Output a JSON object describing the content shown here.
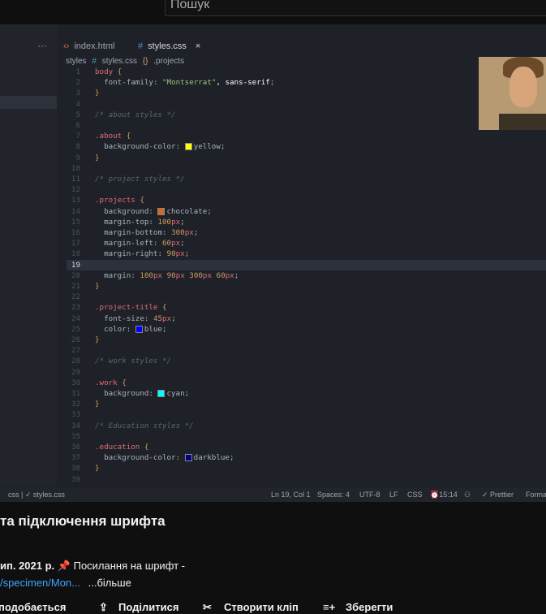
{
  "search": {
    "placeholder": "Пошук"
  },
  "editor": {
    "more_tabs": "···",
    "tabs": [
      {
        "icon": "‹›",
        "label": "index.html"
      },
      {
        "icon": "#",
        "label": "styles.css",
        "close": "×"
      }
    ],
    "breadcrumb": [
      "styles",
      "#",
      "styles.css",
      "{}",
      ".projects"
    ],
    "current_line": 19,
    "lines": [
      {
        "n": 1,
        "text": "body {"
      },
      {
        "n": 2,
        "text": "  font-family: \"Montserrat\", sans-serif;"
      },
      {
        "n": 3,
        "text": "}"
      },
      {
        "n": 4,
        "text": ""
      },
      {
        "n": 5,
        "text": "/* about styles */"
      },
      {
        "n": 6,
        "text": ""
      },
      {
        "n": 7,
        "text": ".about {"
      },
      {
        "n": 8,
        "text": "  background-color: yellow;"
      },
      {
        "n": 9,
        "text": "}"
      },
      {
        "n": 10,
        "text": ""
      },
      {
        "n": 11,
        "text": "/* project styles */"
      },
      {
        "n": 12,
        "text": ""
      },
      {
        "n": 13,
        "text": ".projects {"
      },
      {
        "n": 14,
        "text": "  background: chocolate;"
      },
      {
        "n": 15,
        "text": "  margin-top: 100px;"
      },
      {
        "n": 16,
        "text": "  margin-bottom: 300px;"
      },
      {
        "n": 17,
        "text": "  margin-left: 60px;"
      },
      {
        "n": 18,
        "text": "  margin-right: 90px;"
      },
      {
        "n": 19,
        "text": ""
      },
      {
        "n": 20,
        "text": "  margin: 100px 90px 300px 60px;"
      },
      {
        "n": 21,
        "text": "}"
      },
      {
        "n": 22,
        "text": ""
      },
      {
        "n": 23,
        "text": ".project-title {"
      },
      {
        "n": 24,
        "text": "  font-size: 45px;"
      },
      {
        "n": 25,
        "text": "  color: blue;"
      },
      {
        "n": 26,
        "text": "}"
      },
      {
        "n": 27,
        "text": ""
      },
      {
        "n": 28,
        "text": "/* work styles */"
      },
      {
        "n": 29,
        "text": ""
      },
      {
        "n": 30,
        "text": ".work {"
      },
      {
        "n": 31,
        "text": "  background: cyan;"
      },
      {
        "n": 32,
        "text": "}"
      },
      {
        "n": 33,
        "text": ""
      },
      {
        "n": 34,
        "text": "/* Education styles */"
      },
      {
        "n": 35,
        "text": ""
      },
      {
        "n": 36,
        "text": ".education {"
      },
      {
        "n": 37,
        "text": "  background-color: darkblue;"
      },
      {
        "n": 38,
        "text": "}"
      },
      {
        "n": 39,
        "text": ""
      }
    ],
    "swatches": {
      "yellow": "#ffff00",
      "chocolate": "#d2691e",
      "blue": "#0000ff",
      "cyan": "#00ffff",
      "darkblue": "#00008b"
    }
  },
  "statusbar": {
    "left": "css | ✓ styles.css",
    "position": "Ln 19, Col 1",
    "spaces": "Spaces: 4",
    "encoding": "UTF-8",
    "eol": "LF",
    "language": "CSS",
    "time": "⏰15:14",
    "prettier": "✓ Prettier",
    "format": "Forma"
  },
  "video_title": "та підключення шрифта",
  "description": {
    "date": "ип. 2021 р.",
    "pin": "📌",
    "text": "Посилання на шрифт -",
    "link": "/specimen/Mon...",
    "more": "...більше"
  },
  "actions": {
    "like": "подобається",
    "share": "Поділитися",
    "clip": "Створити кліп",
    "save": "Зберегти"
  }
}
